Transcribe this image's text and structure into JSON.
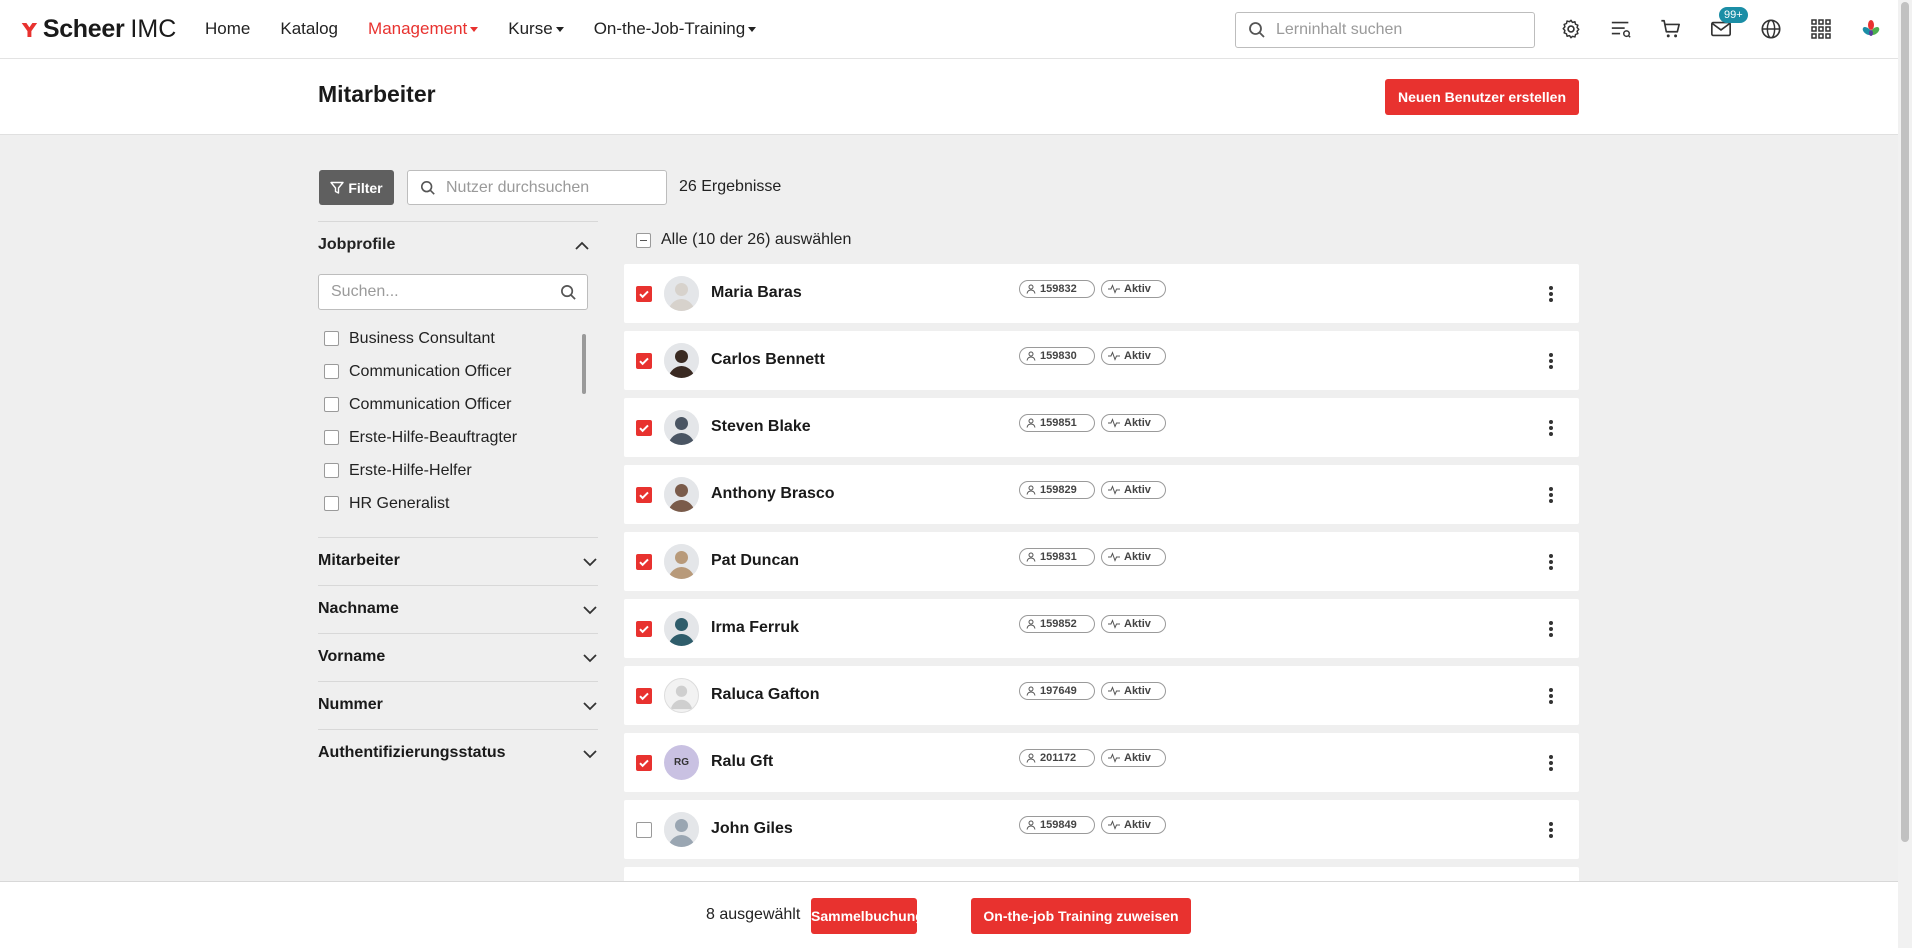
{
  "app": {
    "brand": "Scheer",
    "brand_suffix": "IMC"
  },
  "nav": {
    "items": [
      {
        "label": "Home",
        "dropdown": false,
        "active": false
      },
      {
        "label": "Katalog",
        "dropdown": false,
        "active": false
      },
      {
        "label": "Management",
        "dropdown": true,
        "active": true
      },
      {
        "label": "Kurse",
        "dropdown": true,
        "active": false
      },
      {
        "label": "On-the-Job-Training",
        "dropdown": true,
        "active": false
      }
    ],
    "search_placeholder": "Lerninhalt suchen",
    "messages_badge": "99+",
    "icons": [
      "gear-icon",
      "playlist-icon",
      "cart-icon",
      "mail-icon",
      "globe-icon",
      "apps-grid-icon",
      "logo-mark-icon"
    ]
  },
  "header": {
    "title": "Mitarbeiter",
    "create_button": "Neuen Benutzer erstellen"
  },
  "toolbar": {
    "filter_label": "Filter",
    "search_placeholder": "Nutzer durchsuchen",
    "results": "26 Ergebnisse"
  },
  "filters": {
    "jobprofile": {
      "title": "Jobprofile",
      "search_placeholder": "Suchen...",
      "items": [
        "Business Consultant",
        "Communication Officer",
        "Communication Officer",
        "Erste-Hilfe-Beauftragter",
        "Erste-Hilfe-Helfer",
        "HR Generalist"
      ]
    },
    "collapsed": [
      "Mitarbeiter",
      "Nachname",
      "Vorname",
      "Nummer",
      "Authentifizierungsstatus"
    ]
  },
  "list": {
    "select_all": "Alle (10 der 26) auswählen",
    "users": [
      {
        "name": "Maria Baras",
        "id": "159832",
        "status": "Aktiv",
        "checked": true,
        "avatar": "photo"
      },
      {
        "name": "Carlos Bennett",
        "id": "159830",
        "status": "Aktiv",
        "checked": true,
        "avatar": "photo"
      },
      {
        "name": "Steven Blake",
        "id": "159851",
        "status": "Aktiv",
        "checked": true,
        "avatar": "photo"
      },
      {
        "name": "Anthony Brasco",
        "id": "159829",
        "status": "Aktiv",
        "checked": true,
        "avatar": "photo"
      },
      {
        "name": "Pat Duncan",
        "id": "159831",
        "status": "Aktiv",
        "checked": true,
        "avatar": "photo"
      },
      {
        "name": "Irma Ferruk",
        "id": "159852",
        "status": "Aktiv",
        "checked": true,
        "avatar": "photo"
      },
      {
        "name": "Raluca Gafton",
        "id": "197649",
        "status": "Aktiv",
        "checked": true,
        "avatar": "placeholder"
      },
      {
        "name": "Ralu Gft",
        "id": "201172",
        "status": "Aktiv",
        "checked": true,
        "avatar": "initials",
        "initials": "RG"
      },
      {
        "name": "John Giles",
        "id": "159849",
        "status": "Aktiv",
        "checked": false,
        "avatar": "photo"
      }
    ]
  },
  "bottom": {
    "selected": "8 ausgewählt",
    "sammel_button": "Sammelbuchung",
    "ojt_button": "On-the-job Training zuweisen"
  },
  "colors": {
    "accent": "#e8322f",
    "badge": "#1b8ea6",
    "filter_button": "#5f5f5f"
  }
}
